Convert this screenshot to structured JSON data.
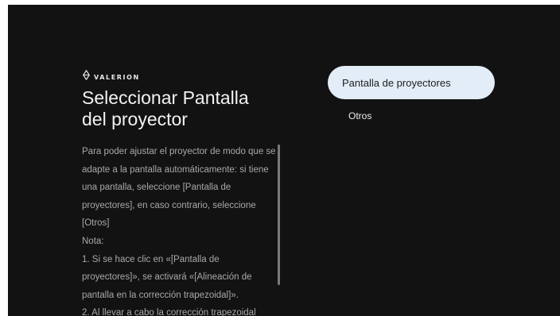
{
  "brand": {
    "logo_icon": "valerion-diamond-icon",
    "name": "VALERION"
  },
  "title": {
    "line1": "Seleccionar Pantalla",
    "line2": "del proyector"
  },
  "description": [
    "Para poder ajustar el proyector de modo que se adapte a la pantalla automáticamente: si tiene una pantalla, seleccione [Pantalla de proyectores], en caso contrario, seleccione [Otros]",
    "Nota:",
    "1. Si se hace clic en «[Pantalla de proyectores]», se activará «[Alineación de pantalla en la corrección trapezoidal]».",
    "2. Al llevar a cabo la corrección trapezoidal"
  ],
  "options": [
    {
      "label": "Pantalla de proyectores",
      "selected": true
    },
    {
      "label": "Otros",
      "selected": false
    }
  ],
  "colors": {
    "background": "#121212",
    "selected_option_bg": "#e3edf7",
    "text_primary": "#f2f2f2",
    "text_secondary": "#a9a9a9"
  }
}
